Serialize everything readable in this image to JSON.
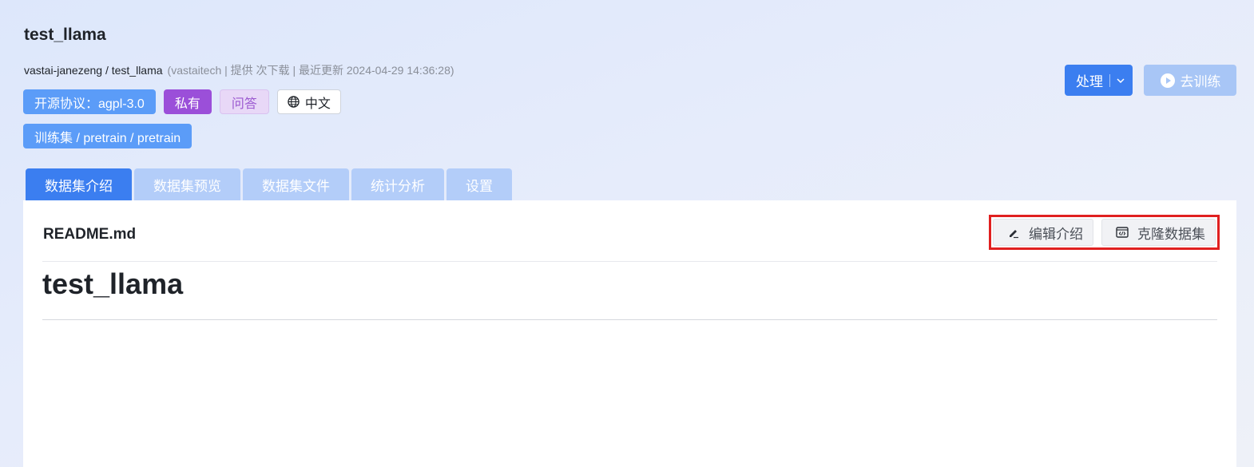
{
  "header": {
    "title": "test_llama",
    "path": "vastai-janezeng / test_llama",
    "meta": "(vastaitech | 提供 次下载 | 最近更新 2024-04-29 14:36:28)"
  },
  "tags": {
    "license": "开源协议：agpl-3.0",
    "visibility": "私有",
    "task": "问答",
    "language": "中文",
    "trainset": "训练集 / pretrain / pretrain"
  },
  "actions": {
    "process_label": "处理",
    "train_label": "去训练"
  },
  "tabs": [
    {
      "label": "数据集介绍",
      "active": true
    },
    {
      "label": "数据集预览",
      "active": false
    },
    {
      "label": "数据集文件",
      "active": false
    },
    {
      "label": "统计分析",
      "active": false
    },
    {
      "label": "设置",
      "active": false
    }
  ],
  "panel": {
    "filename": "README.md",
    "edit_label": "编辑介绍",
    "clone_label": "克隆数据集",
    "doc_title": "test_llama"
  },
  "colors": {
    "primary": "#3b7ef0",
    "tag_blue": "#5b9cf8",
    "tag_purple": "#9b4fd9",
    "highlight_border": "#e02020"
  },
  "icons": {
    "language": "globe-icon",
    "process_menu": "chevron-down-icon",
    "train": "play-circle-icon",
    "edit": "pen-icon",
    "clone": "code-window-icon"
  }
}
